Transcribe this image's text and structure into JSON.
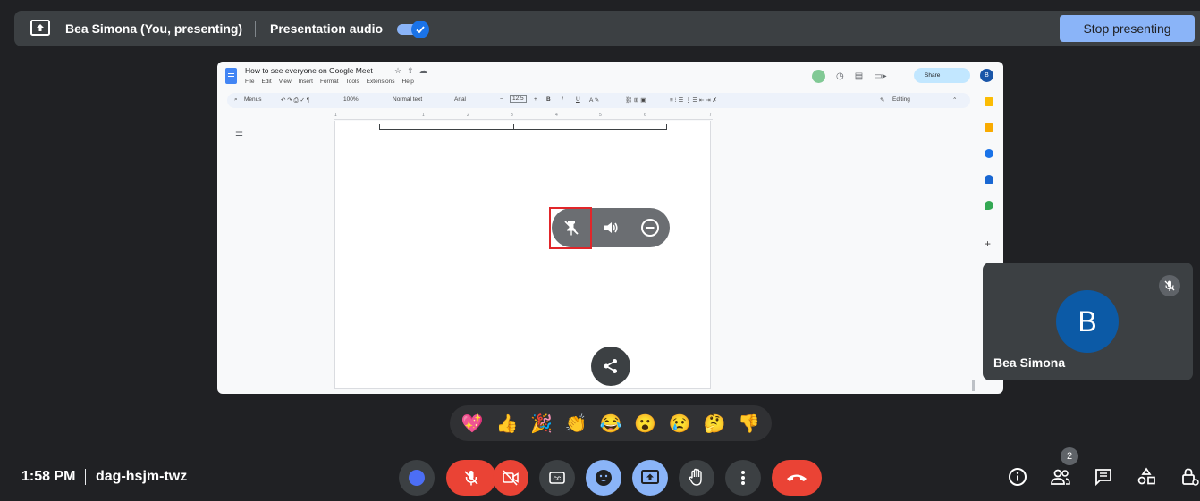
{
  "topbar": {
    "presenter": "Bea Simona (You, presenting)",
    "audio_label": "Presentation audio",
    "audio_enabled": true,
    "stop_label": "Stop presenting"
  },
  "shared_doc": {
    "title": "How to see everyone on Google Meet",
    "menu": [
      "File",
      "Edit",
      "View",
      "Insert",
      "Format",
      "Tools",
      "Extensions",
      "Help"
    ],
    "toolbar": {
      "search": "Menus",
      "zoom": "100%",
      "style": "Normal text",
      "font": "Arial",
      "size": "12.5",
      "mode": "Editing"
    },
    "share_label": "Share",
    "account_initial": "B",
    "ruler_ticks": [
      "1",
      "1",
      "2",
      "3",
      "4",
      "5",
      "6",
      "7"
    ]
  },
  "hover_controls": [
    "unpin-icon",
    "speaker-icon",
    "remove-icon"
  ],
  "self_tile": {
    "initial": "B",
    "name": "Bea Simona",
    "muted": true
  },
  "reactions": [
    "💖",
    "👍",
    "🎉",
    "👏",
    "😂",
    "😮",
    "😢",
    "🤔",
    "👎"
  ],
  "meeting": {
    "time": "1:58 PM",
    "code": "dag-hsjm-twz"
  },
  "people_count": "2",
  "colors": {
    "background": "#202124",
    "accent": "#8ab4f8",
    "danger": "#ea4335",
    "highlight": "#e1262a"
  }
}
